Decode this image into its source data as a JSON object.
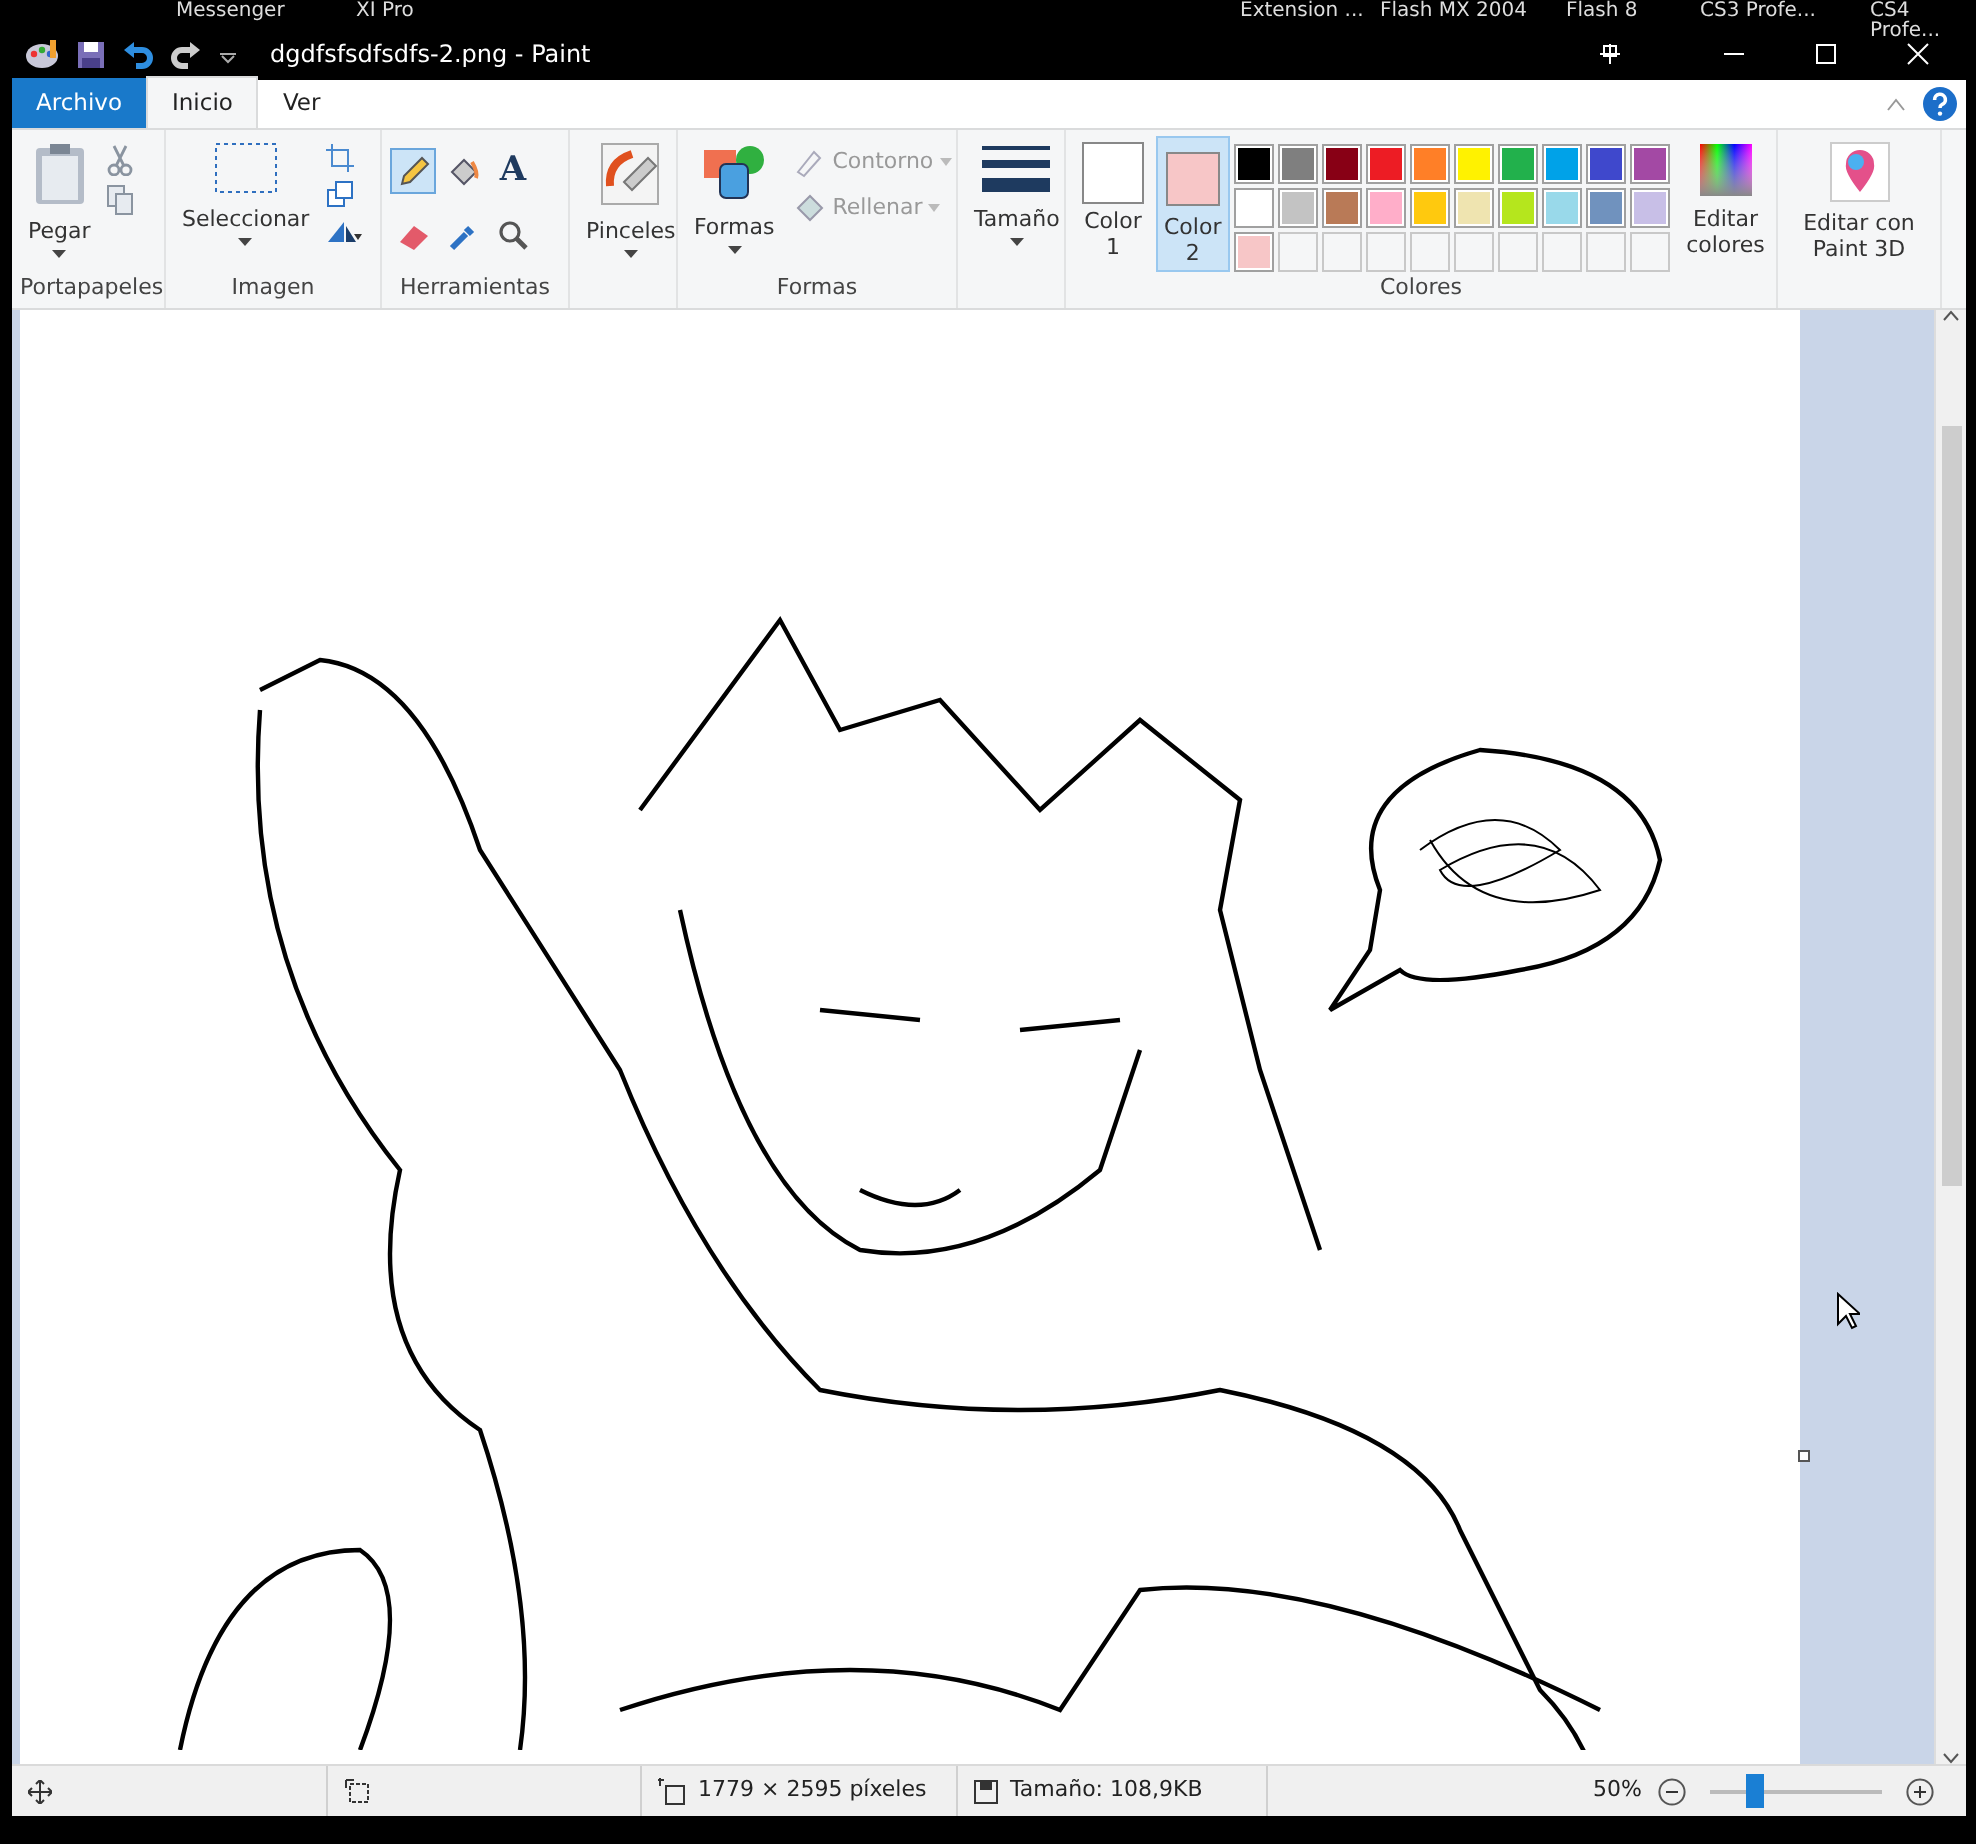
{
  "desktop_taskbar": [
    "Messenger",
    "XI Pro",
    "Extension ...",
    "Flash MX 2004",
    "Flash 8",
    "CS3 Profe...",
    "CS4 Profe..."
  ],
  "title_bar": {
    "title": "dgdfsfsdfsdfs-2.png - Paint"
  },
  "tabs": [
    {
      "label": "Archivo",
      "kind": "file",
      "selected": false
    },
    {
      "label": "Inicio",
      "kind": "tab",
      "selected": true
    },
    {
      "label": "Ver",
      "kind": "tab",
      "selected": false
    }
  ],
  "ribbon": {
    "clipboard": {
      "label": "Portapapeles",
      "paste": "Pegar"
    },
    "image": {
      "label": "Imagen",
      "select": "Seleccionar"
    },
    "tools": {
      "label": "Herramientas",
      "items": [
        {
          "kind": "pencil",
          "selected": true
        },
        {
          "kind": "fill",
          "selected": false
        },
        {
          "kind": "text",
          "label": "A",
          "selected": false
        },
        {
          "kind": "eraser",
          "selected": false
        },
        {
          "kind": "picker",
          "selected": false
        },
        {
          "kind": "magnifier",
          "selected": false
        }
      ]
    },
    "brushes": {
      "label": "Pinceles"
    },
    "shapes": {
      "label": "Formas",
      "button": "Formas",
      "outline": "Contorno",
      "fill": "Rellenar"
    },
    "size": {
      "label": "Tamaño"
    },
    "colors": {
      "label": "Colores",
      "slots": [
        {
          "label": "Color",
          "number": "1",
          "color": "#ffffff",
          "selected": false
        },
        {
          "label": "Color",
          "number": "2",
          "color": "#f7c6c7",
          "selected": true
        }
      ],
      "palette": [
        {
          "color": "#000000"
        },
        {
          "color": "#7f7f7f"
        },
        {
          "color": "#880015"
        },
        {
          "color": "#ed1c24"
        },
        {
          "color": "#ff7f27"
        },
        {
          "color": "#fff200"
        },
        {
          "color": "#22b14c"
        },
        {
          "color": "#00a2e8"
        },
        {
          "color": "#3f48cc"
        },
        {
          "color": "#a349a4"
        },
        {
          "color": "#ffffff"
        },
        {
          "color": "#c3c3c3"
        },
        {
          "color": "#b97a57"
        },
        {
          "color": "#ffaec9"
        },
        {
          "color": "#ffc90e"
        },
        {
          "color": "#efe4b0"
        },
        {
          "color": "#b5e61d"
        },
        {
          "color": "#99d9ea"
        },
        {
          "color": "#7092be"
        },
        {
          "color": "#c8bfe7"
        },
        {
          "color": "#f7c6c7"
        }
      ],
      "edit": "Editar colores"
    },
    "paint3d": {
      "label": "Editar con Paint 3D"
    }
  },
  "status_bar": {
    "dimensions": "1779 × 2595 píxeles",
    "file_size": "Tamaño: 108,9KB",
    "zoom": "50%",
    "zoom_slider": {
      "level": 0.25
    }
  }
}
